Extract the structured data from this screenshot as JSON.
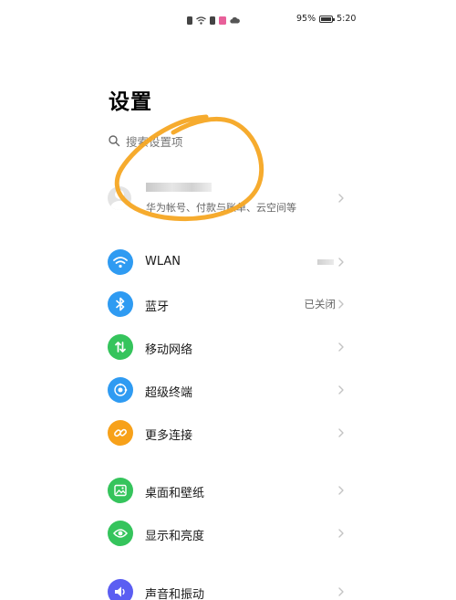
{
  "status_bar": {
    "battery": "95%",
    "battery_level": 0.95,
    "time": "5:20",
    "icons": [
      "sim-icon",
      "wifi-icon",
      "sim-icon",
      "app-notification-icon",
      "cloud-icon"
    ]
  },
  "header": {
    "title": "设置"
  },
  "search": {
    "placeholder": "搜索设置项"
  },
  "account": {
    "subtitle": "华为帐号、付款与账单、云空间等"
  },
  "settings": [
    {
      "label": "WLAN",
      "value": "",
      "icon": "wifi-icon",
      "color": "#2f9bf2"
    },
    {
      "label": "蓝牙",
      "value": "已关闭",
      "icon": "bluetooth-icon",
      "color": "#2f9bf2"
    },
    {
      "label": "移动网络",
      "value": "",
      "icon": "mobile-data-icon",
      "color": "#35c45c"
    },
    {
      "label": "超级终端",
      "value": "",
      "icon": "super-device-icon",
      "color": "#2f9bf2"
    },
    {
      "label": "更多连接",
      "value": "",
      "icon": "link-icon",
      "color": "#f7a11a"
    },
    {
      "label": "桌面和壁纸",
      "value": "",
      "icon": "wallpaper-icon",
      "color": "#35c45c"
    },
    {
      "label": "显示和亮度",
      "value": "",
      "icon": "eye-icon",
      "color": "#35c45c"
    },
    {
      "label": "声音和振动",
      "value": "",
      "icon": "sound-icon",
      "color": "#5b5ef2"
    }
  ],
  "colors": {
    "scribble": "#f5a623",
    "accent_blue": "#2f9bf2",
    "accent_green": "#35c45c",
    "accent_orange": "#f7a11a",
    "accent_purple": "#5b5ef2"
  }
}
